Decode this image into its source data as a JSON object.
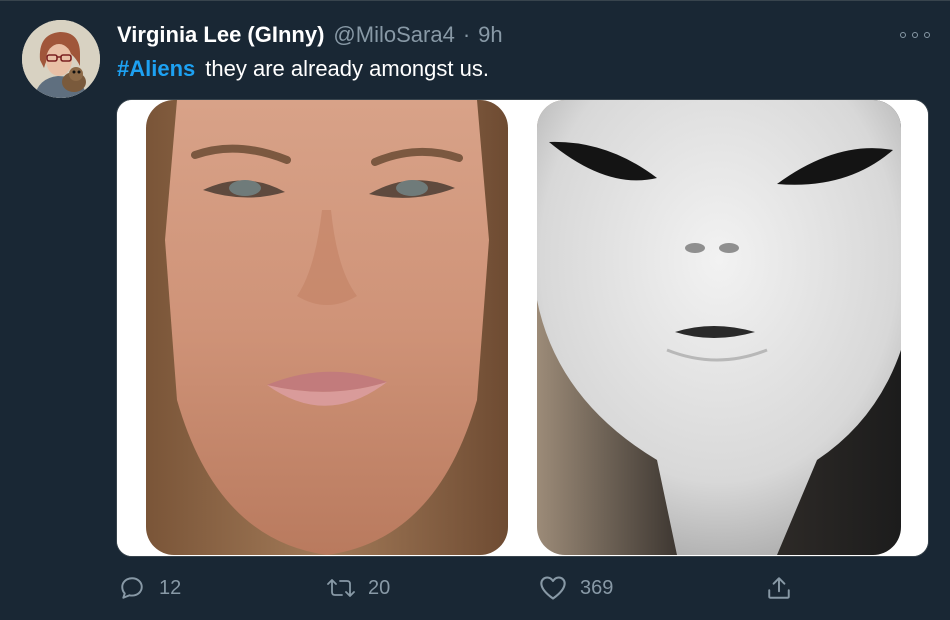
{
  "tweet": {
    "author_name": "Virginia Lee (GInny)",
    "handle": "@MiloSara4",
    "separator": "·",
    "time": "9h",
    "hashtag": "#Aliens",
    "body": "they are already amongst us.",
    "replies": "12",
    "retweets": "20",
    "likes": "369"
  },
  "icons": {
    "more": "more-horizontal-icon",
    "reply": "reply-bubble-icon",
    "retweet": "retweet-arrows-icon",
    "like": "heart-icon",
    "share": "share-upload-icon"
  },
  "colors": {
    "background": "#192734",
    "accent": "#1da1f2",
    "secondary_text": "#8899a6"
  }
}
